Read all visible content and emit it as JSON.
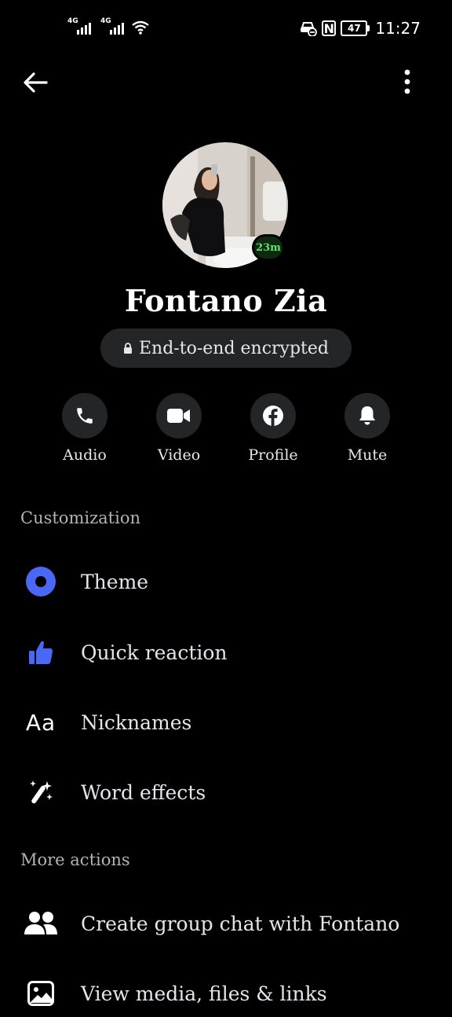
{
  "status_bar": {
    "sim1": "4G",
    "sim2": "4G",
    "battery": "47",
    "time": "11:27"
  },
  "contact": {
    "name": "Fontano Zia",
    "active_badge": "23m",
    "encryption_label": "End-to-end encrypted"
  },
  "actions": [
    {
      "label": "Audio",
      "icon": "phone-icon"
    },
    {
      "label": "Video",
      "icon": "video-camera-icon"
    },
    {
      "label": "Profile",
      "icon": "facebook-icon"
    },
    {
      "label": "Mute",
      "icon": "bell-icon"
    }
  ],
  "customization": {
    "header": "Customization",
    "items": [
      {
        "label": "Theme",
        "icon": "theme-circle-icon"
      },
      {
        "label": "Quick reaction",
        "icon": "thumbs-up-icon"
      },
      {
        "label": "Nicknames",
        "icon": "aa-text-icon"
      },
      {
        "label": "Word effects",
        "icon": "sparkle-wand-icon"
      }
    ]
  },
  "more_actions": {
    "header": "More actions",
    "items": [
      {
        "label": "Create group chat with Fontano",
        "icon": "people-icon"
      },
      {
        "label": "View media, files & links",
        "icon": "image-icon"
      }
    ]
  },
  "colors": {
    "background": "#000000",
    "accent_blue": "#4a67f5",
    "pill_background": "#242526",
    "active_green": "#5fe36a"
  }
}
